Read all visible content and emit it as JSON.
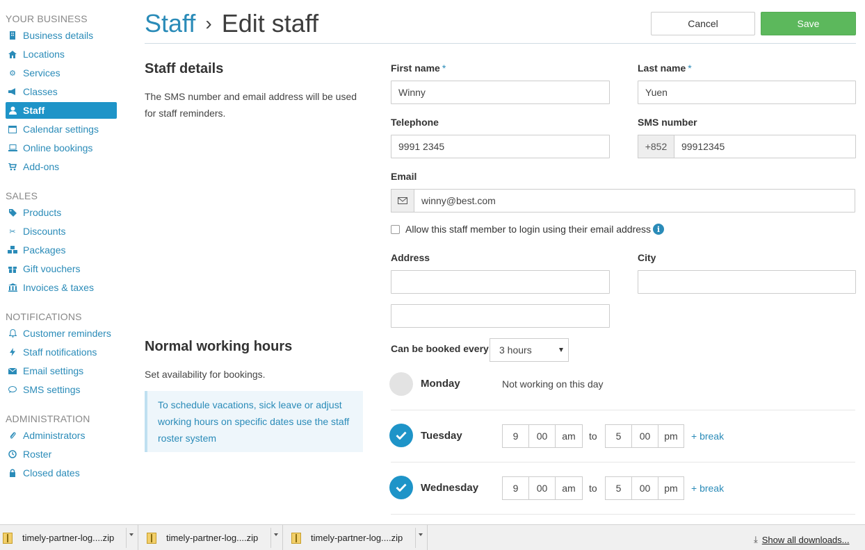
{
  "sidebar": {
    "sections": [
      {
        "title": "YOUR BUSINESS",
        "items": [
          {
            "label": "Business details",
            "icon": "building-icon"
          },
          {
            "label": "Locations",
            "icon": "home-icon"
          },
          {
            "label": "Services",
            "icon": "gear-icon"
          },
          {
            "label": "Classes",
            "icon": "megaphone-icon"
          },
          {
            "label": "Staff",
            "icon": "user-icon",
            "active": true
          },
          {
            "label": "Calendar settings",
            "icon": "calendar-icon"
          },
          {
            "label": "Online bookings",
            "icon": "laptop-icon"
          },
          {
            "label": "Add-ons",
            "icon": "cart-icon"
          }
        ]
      },
      {
        "title": "SALES",
        "items": [
          {
            "label": "Products",
            "icon": "tag-icon"
          },
          {
            "label": "Discounts",
            "icon": "scissors-icon"
          },
          {
            "label": "Packages",
            "icon": "cubes-icon"
          },
          {
            "label": "Gift vouchers",
            "icon": "gift-icon"
          },
          {
            "label": "Invoices & taxes",
            "icon": "bank-icon"
          }
        ]
      },
      {
        "title": "NOTIFICATIONS",
        "items": [
          {
            "label": "Customer reminders",
            "icon": "bell-icon"
          },
          {
            "label": "Staff notifications",
            "icon": "bolt-icon"
          },
          {
            "label": "Email settings",
            "icon": "envelope-icon"
          },
          {
            "label": "SMS settings",
            "icon": "chat-icon"
          }
        ]
      },
      {
        "title": "ADMINISTRATION",
        "items": [
          {
            "label": "Administrators",
            "icon": "paperclip-icon"
          },
          {
            "label": "Roster",
            "icon": "clock-icon"
          },
          {
            "label": "Closed dates",
            "icon": "lock-icon"
          }
        ]
      }
    ]
  },
  "header": {
    "breadcrumb_link": "Staff",
    "breadcrumb_sep": "›",
    "title": "Edit staff",
    "cancel_label": "Cancel",
    "save_label": "Save"
  },
  "staff_details": {
    "heading": "Staff details",
    "description": "The SMS number and email address will be used for staff reminders."
  },
  "form": {
    "first_name_label": "First name",
    "first_name_value": "Winny",
    "last_name_label": "Last name",
    "last_name_value": "Yuen",
    "required_mark": "*",
    "telephone_label": "Telephone",
    "telephone_value": "9991 2345",
    "sms_label": "SMS number",
    "sms_prefix": "+852",
    "sms_value": "99912345",
    "email_label": "Email",
    "email_value": "winny@best.com",
    "allow_login_label": "Allow this staff member to login using their email address",
    "address_label": "Address",
    "address_line1": "",
    "address_line2": "",
    "city_label": "City",
    "city_value": "",
    "booked_every_label": "Can be booked every",
    "booked_every_value": "3 hours"
  },
  "working_hours": {
    "heading": "Normal working hours",
    "description": "Set availability for bookings.",
    "note": "To schedule vacations, sick leave or adjust working hours on specific dates use the staff roster system",
    "days": [
      {
        "name": "Monday",
        "working": false,
        "status": "Not working on this day"
      },
      {
        "name": "Tuesday",
        "working": true,
        "start_h": "9",
        "start_m": "00",
        "start_ap": "am",
        "to": "to",
        "end_h": "5",
        "end_m": "00",
        "end_ap": "pm",
        "break": "+ break"
      },
      {
        "name": "Wednesday",
        "working": true,
        "start_h": "9",
        "start_m": "00",
        "start_ap": "am",
        "to": "to",
        "end_h": "5",
        "end_m": "00",
        "end_ap": "pm",
        "break": "+ break"
      }
    ]
  },
  "downloads": {
    "items": [
      "timely-partner-log....zip",
      "timely-partner-log....zip",
      "timely-partner-log....zip"
    ],
    "show_all": "Show all downloads..."
  },
  "colors": {
    "accent": "#1e94c8",
    "save": "#5cb85c"
  }
}
